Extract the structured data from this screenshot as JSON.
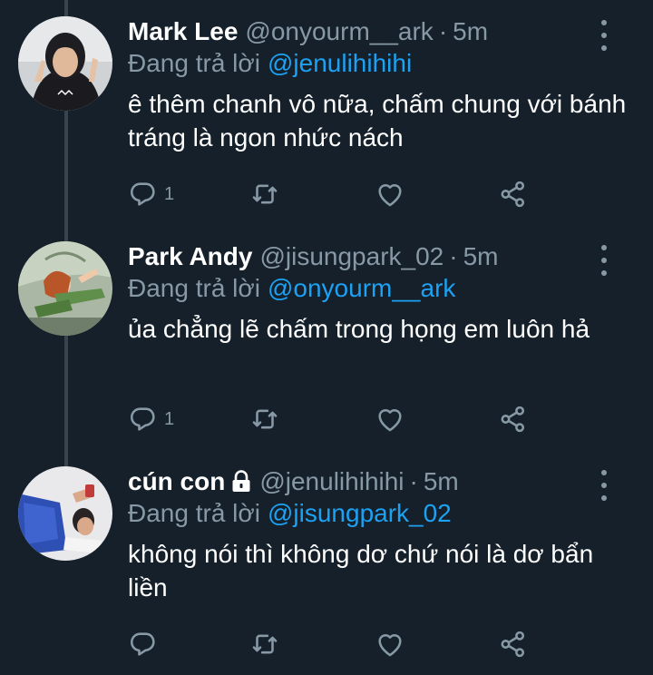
{
  "replies": [
    {
      "name": "Mark Lee",
      "handle": "@onyourm__ark",
      "separator": "·",
      "time": "5m",
      "protected": false,
      "reply_prefix": "Đang trả lời",
      "reply_to": "@jenulihihihi",
      "text": "ê thêm chanh vô nữa, chấm chung với bánh tráng là ngon nhức nách",
      "reply_count": "1"
    },
    {
      "name": "Park Andy",
      "handle": "@jisungpark_02",
      "separator": "·",
      "time": "5m",
      "protected": false,
      "reply_prefix": "Đang trả lời",
      "reply_to": "@onyourm__ark",
      "text": "ủa chẳng lẽ chấm trong họng em luôn hả",
      "reply_count": "1"
    },
    {
      "name": "cún con",
      "handle": "@jenulihihihi",
      "separator": "·",
      "time": "5m",
      "protected": true,
      "reply_prefix": "Đang trả lời",
      "reply_to": "@jisungpark_02",
      "text": "không nói thì không dơ chứ nói là dơ bẩn liền",
      "reply_count": ""
    }
  ],
  "icons": [
    "reply-icon",
    "retweet-icon",
    "like-icon",
    "share-icon",
    "more-options-icon",
    "lock-icon"
  ],
  "colors": {
    "background": "#15202b",
    "secondary_text": "#8899a6",
    "mention": "#1da1f2",
    "thread_line": "#38444d"
  }
}
